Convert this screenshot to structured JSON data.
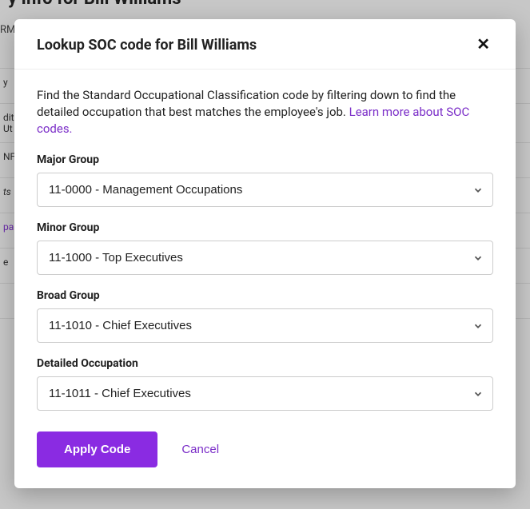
{
  "background": {
    "heading_fragment": "y Info for Bill Williams",
    "line1": "RM.",
    "cells": [
      "y",
      "diti",
      "Ut",
      "NF",
      "ts",
      "pan",
      "e"
    ]
  },
  "modal": {
    "title": "Lookup SOC code for Bill Williams",
    "description_lead": "Find the Standard Occupational Classification code by filtering down to find the detailed occupation that best matches the employee's job. ",
    "learn_more": "Learn more about SOC codes.",
    "fields": {
      "major": {
        "label": "Major Group",
        "value": "11-0000  -  Management Occupations"
      },
      "minor": {
        "label": "Minor Group",
        "value": "11-1000 -  Top Executives"
      },
      "broad": {
        "label": "Broad Group",
        "value": "11-1010 -  Chief Executives"
      },
      "detailed": {
        "label": "Detailed Occupation",
        "value": "11-1011 -  Chief Executives"
      }
    },
    "apply_label": "Apply Code",
    "cancel_label": "Cancel"
  }
}
